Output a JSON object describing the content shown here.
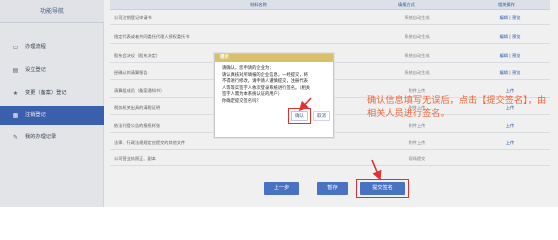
{
  "sidebar": {
    "title": "功能导航",
    "items": [
      {
        "icon": "folder-icon",
        "glyph": "▭",
        "label": "办理流程"
      },
      {
        "icon": "document-icon",
        "glyph": "▤",
        "label": "设立登记"
      },
      {
        "icon": "star-icon",
        "glyph": "★",
        "label": "变更（备案）登记"
      },
      {
        "icon": "cancel-icon",
        "glyph": "▦",
        "label": "注销登记"
      },
      {
        "icon": "pen-icon",
        "glyph": "✎",
        "label": "我的办理记录"
      }
    ],
    "active_index": 3
  },
  "table": {
    "headers": {
      "name": "材料名称",
      "mode": "填报方式",
      "action": "相关操作"
    },
    "rows": [
      {
        "name": "公司注销登记申请书",
        "mode": "系统自动生成",
        "action": "编辑 | 预览"
      },
      {
        "name": "指定代表或者共同委托代理人授权委托书",
        "mode": "系统自动生成",
        "action": "编辑 | 预览"
      },
      {
        "name": "股东会决议（股东决定）",
        "mode": "系统自动生成",
        "action": "编辑 | 预览"
      },
      {
        "name": "经确认的清算报告",
        "mode": "系统自动生成",
        "action": "编辑 | 预览"
      },
      {
        "name": "清算组成员（备案通知书）",
        "mode": "附件上传",
        "action": "上传"
      },
      {
        "name": "税务机关出具的清税证明",
        "mode": "附件上传",
        "action": "上传"
      },
      {
        "name": "依法刊登公告的报纸样张",
        "mode": "附件上传",
        "action": "上传"
      },
      {
        "name": "法律、行政法规规定应提交的其他文件",
        "mode": "附件上传",
        "action": "上传"
      },
      {
        "name": "公司营业执照正、副本",
        "mode": "现场提交",
        "action": ""
      }
    ]
  },
  "modal": {
    "title": "提示",
    "lines": [
      "请确认，您申请的企业为：",
      "请认真核对所填报的企业信息，一经提交，将",
      "不得进行修改，请申请人谨慎提交，注册代表",
      "人等等实签字人依次登录系统进行签名。（相关",
      "签字人需为本系统认证的用户）",
      "你确定提交签名吗？"
    ],
    "confirm_label": "确认",
    "cancel_label": "取消"
  },
  "annotation": "确认信息填写无误后，点击【提交签名】，由相关人员进行签名。",
  "buttons": {
    "prev": "上一步",
    "save": "暂存",
    "submit": "提交签名"
  }
}
